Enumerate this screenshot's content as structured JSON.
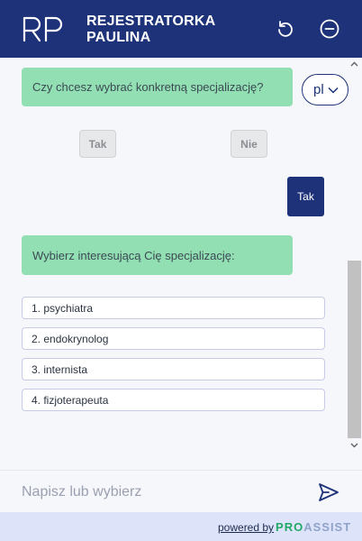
{
  "header": {
    "logo_text": "RP",
    "title_line1": "REJESTRATORKA",
    "title_line2": "PAULINA",
    "refresh_icon": "refresh-icon",
    "minimize_icon": "minus-circle-icon"
  },
  "chat": {
    "question1": "Czy chcesz wybrać konkretną specjalizację?",
    "language": "pl",
    "choices": [
      "Tak",
      "Nie"
    ],
    "user_reply": "Tak",
    "question2": "Wybierz interesującą Cię specjalizację:",
    "options": [
      "1. psychiatra",
      "2. endokrynolog",
      "3. internista",
      "4. fizjoterapeuta"
    ]
  },
  "input": {
    "placeholder": "Napisz lub wybierz",
    "send_icon": "send-icon"
  },
  "footer": {
    "powered_by": "powered by",
    "brand_part1": "PRO",
    "brand_part2": "ASSIST"
  },
  "colors": {
    "header": "#1d3278",
    "bot_bubble": "#92dfb3",
    "user_bubble": "#1d3278",
    "footer": "#dde4fa"
  }
}
